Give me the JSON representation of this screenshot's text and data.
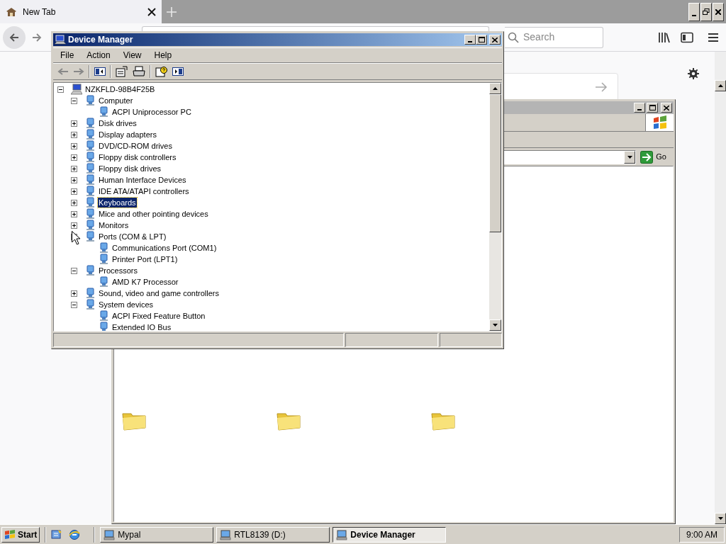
{
  "browser": {
    "tabs": [
      {
        "title": "New Tab",
        "selected": true
      }
    ],
    "search": {
      "placeholder": "Search"
    }
  },
  "explorer_window": {
    "go_button": "Go"
  },
  "device_manager": {
    "title": "Device Manager",
    "menu": [
      "File",
      "Action",
      "View",
      "Help"
    ],
    "tree": {
      "label": "NZKFLD-98B4F25B",
      "expanded": true,
      "children": [
        {
          "label": "Computer",
          "expanded": true,
          "selected": false,
          "children": [
            {
              "label": "ACPI Uniprocessor PC"
            }
          ]
        },
        {
          "label": "Disk drives",
          "expanded": false,
          "selected": false
        },
        {
          "label": "Display adapters",
          "expanded": false,
          "selected": false
        },
        {
          "label": "DVD/CD-ROM drives",
          "expanded": false,
          "selected": false
        },
        {
          "label": "Floppy disk controllers",
          "expanded": false,
          "selected": false
        },
        {
          "label": "Floppy disk drives",
          "expanded": false,
          "selected": false
        },
        {
          "label": "Human Interface Devices",
          "expanded": false,
          "selected": false
        },
        {
          "label": "IDE ATA/ATAPI controllers",
          "expanded": false,
          "selected": false
        },
        {
          "label": "Keyboards",
          "expanded": false,
          "selected": true
        },
        {
          "label": "Mice and other pointing devices",
          "expanded": false,
          "selected": false
        },
        {
          "label": "Monitors",
          "expanded": false,
          "selected": false
        },
        {
          "label": "Ports (COM & LPT)",
          "expanded": true,
          "selected": false,
          "children": [
            {
              "label": "Communications Port (COM1)"
            },
            {
              "label": "Printer Port (LPT1)"
            }
          ]
        },
        {
          "label": "Processors",
          "expanded": true,
          "selected": false,
          "children": [
            {
              "label": "AMD K7 Processor"
            }
          ]
        },
        {
          "label": "Sound, video and game controllers",
          "expanded": false,
          "selected": false
        },
        {
          "label": "System devices",
          "expanded": true,
          "selected": false,
          "children": [
            {
              "label": "ACPI Fixed Feature Button"
            },
            {
              "label": "Extended IO Bus"
            }
          ]
        }
      ]
    }
  },
  "taskbar": {
    "start": "Start",
    "tasks": [
      {
        "label": "Mypal",
        "selected": false
      },
      {
        "label": "RTL8139 (D:)",
        "selected": false
      },
      {
        "label": "Device Manager",
        "selected": true
      }
    ],
    "clock": "9:00 AM"
  }
}
